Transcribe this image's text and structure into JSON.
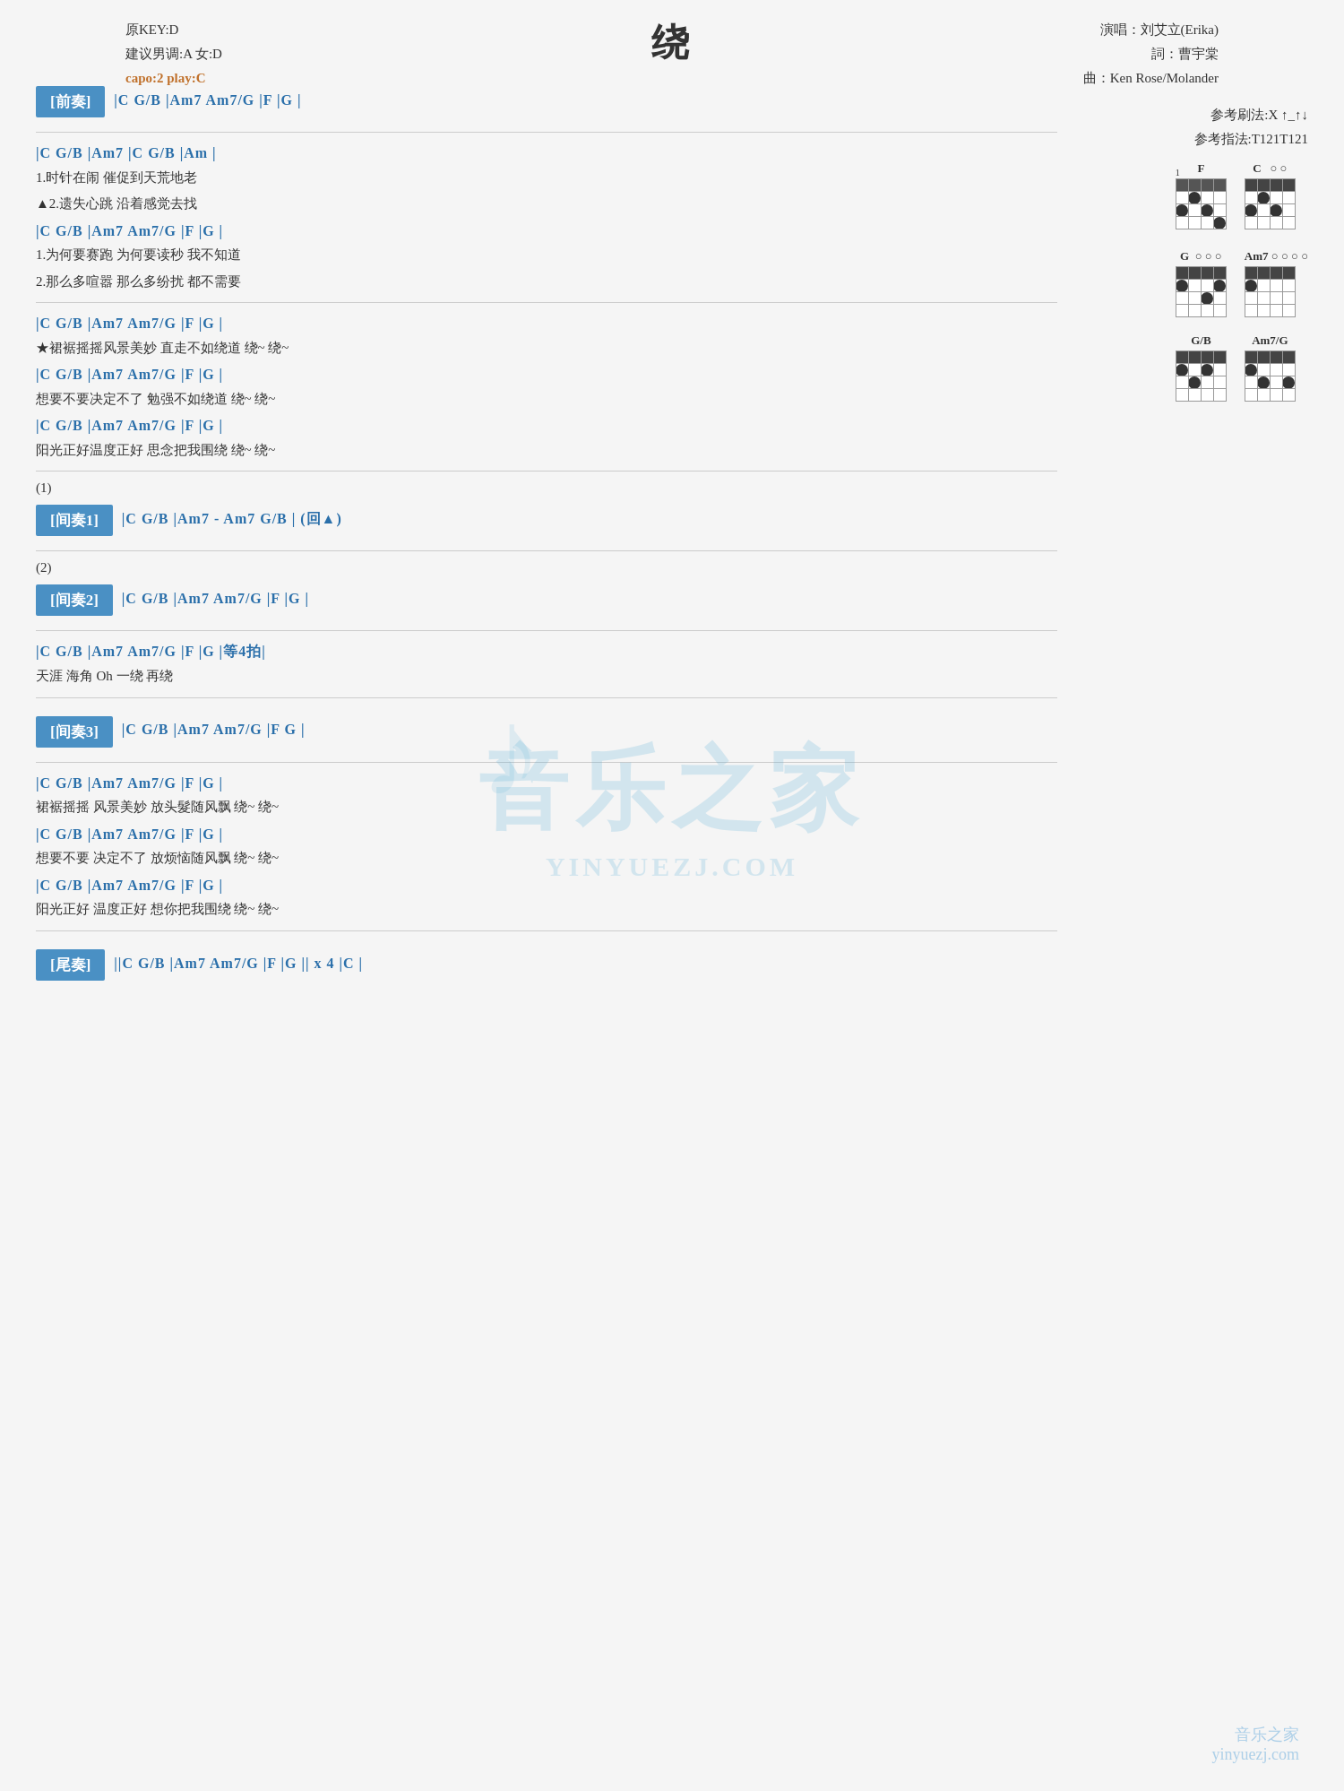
{
  "song": {
    "title": "绕",
    "original_key": "原KEY:D",
    "suggested_key": "建议男调:A 女:D",
    "capo": "capo:2 play:C",
    "performer": "演唱：刘艾立(Erika)",
    "lyrics_by": "詞：曹宇棠",
    "music_by": "曲：Ken Rose/Molander",
    "ref_strum": "参考刷法:X ↑_↑↓",
    "ref_finger": "参考指法:T121T121"
  },
  "intro": {
    "label": "[前奏]",
    "chords": "|C  G/B  |Am7  Am7/G  |F  |G  |"
  },
  "verse1": {
    "chord1": "|C   G/B   |Am7         |C   G/B  |Am  |",
    "lyric1a": "1.时针在闹    催促到天荒地老",
    "lyric1b": "▲2.遗失心跳    沿着感觉去找",
    "chord2": "|C           G/B         |Am7  Am7/G  |F   |G  |",
    "lyric2a": "1.为何要赛跑    为何要读秒                   我不知道",
    "lyric2b": "2.那么多喧嚣    那么多纷扰                   都不需要"
  },
  "chorus": {
    "chord1": "|C      G/B       |Am7      Am7/G  |F      |G  |",
    "lyric1": "★裙裾摇摇风景美妙    直走不如绕道       绕~    绕~",
    "chord2": "|C      G/B       |Am7      Am7/G  |F      |G  |",
    "lyric2": "想要不要决定不了      勉强不如绕道       绕~    绕~",
    "chord3": "|C      G/B       |Am7      Am7/G  |F      |G  |",
    "lyric3": "阳光正好温度正好      思念把我围绕       绕~    绕~"
  },
  "interlude1": {
    "paren": "(1)",
    "label": "[间奏1]",
    "chords": "|C   G/B    |Am7 - Am7   G/B  | (回▲)"
  },
  "interlude2": {
    "paren": "(2)",
    "label": "[间奏2]",
    "chords": "|C   G/B   |Am7  Am7/G  |F   |G  |"
  },
  "bridge": {
    "chord1": "|C   G/B  |Am7  Am7/G  |F    |G    |等4拍|",
    "lyric1": "天涯    海角                      Oh   一绕   再绕"
  },
  "interlude3": {
    "label": "[间奏3]",
    "chords": "|C   G/B   |Am7  Am7/G  |F  G  |"
  },
  "verse2": {
    "chord1": "|C           G/B       |Am7      Am7/G  |F      |G  |",
    "lyric1": "裙裾摇摇    风景美妙    放头髮随风飘       绕~    绕~",
    "chord2": "|C           G/B       |Am7      Am7/G  |F      |G  |",
    "lyric2": "想要不要    决定不了    放烦恼随风飘       绕~    绕~",
    "chord3": "|C           G/B       |Am7      Am7/G  |F      |G  |",
    "lyric3": "阳光正好    温度正好    想你把我围绕       绕~    绕~"
  },
  "outro": {
    "label": "[尾奏]",
    "chords": "||C  G/B  |Am7  Am7/G  |F   |G  || x 4 |C  |"
  },
  "chord_diagrams": {
    "row1": [
      {
        "name": "F",
        "fret_marker": "1"
      },
      {
        "name": "C",
        "open_strings": "o o"
      }
    ],
    "row2": [
      {
        "name": "G",
        "open_strings": "o o o"
      },
      {
        "name": "Am7",
        "open_strings": "o o o o"
      }
    ],
    "row3": [
      {
        "name": "G/B"
      },
      {
        "name": "Am7/G"
      }
    ]
  },
  "watermark": {
    "text": "音乐之家",
    "url": "YINYUEZJ.COM",
    "bottom_line1": "音乐之家",
    "bottom_line2": "yinyuezj.com"
  }
}
